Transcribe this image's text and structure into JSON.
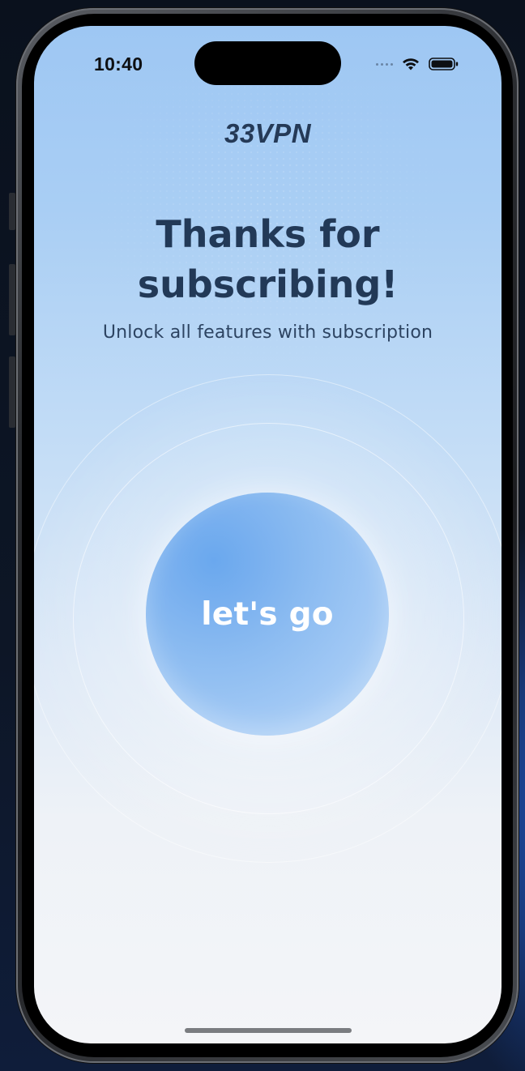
{
  "status_bar": {
    "time": "10:40",
    "signal_icon": "cellular-dots-icon",
    "wifi_icon": "wifi-icon",
    "battery_icon": "battery-icon"
  },
  "header": {
    "brand": "33VPN"
  },
  "main": {
    "headline_line1": "Thanks for",
    "headline_line2": "subscribing!",
    "subtitle": "Unlock all features with subscription",
    "cta_label": "let's go"
  },
  "colors": {
    "headline": "#223957",
    "orb": "#79b0ef",
    "background_top": "#9ec7f3",
    "background_bottom": "#f4f5f8"
  }
}
